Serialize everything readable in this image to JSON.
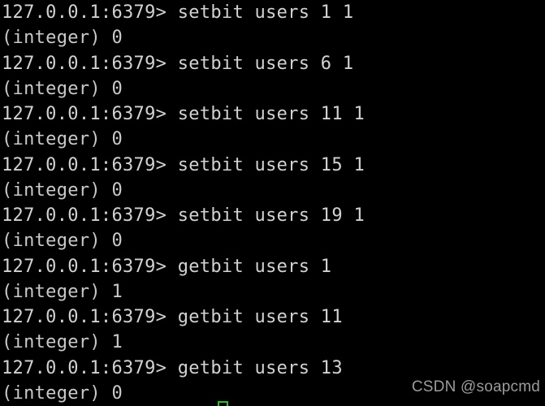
{
  "terminal": {
    "background_color": "#000000",
    "text_color": "#cfcfcf",
    "cursor_color": "#22c322",
    "prompt": "127.0.0.1:6379>",
    "lines": [
      {
        "type": "prompt",
        "text": "127.0.0.1:6379> setbit users 1 1"
      },
      {
        "type": "reply",
        "text": "(integer) 0"
      },
      {
        "type": "prompt",
        "text": "127.0.0.1:6379> setbit users 6 1"
      },
      {
        "type": "reply",
        "text": "(integer) 0"
      },
      {
        "type": "prompt",
        "text": "127.0.0.1:6379> setbit users 11 1"
      },
      {
        "type": "reply",
        "text": "(integer) 0"
      },
      {
        "type": "prompt",
        "text": "127.0.0.1:6379> setbit users 15 1"
      },
      {
        "type": "reply",
        "text": "(integer) 0"
      },
      {
        "type": "prompt",
        "text": "127.0.0.1:6379> setbit users 19 1"
      },
      {
        "type": "reply",
        "text": "(integer) 0"
      },
      {
        "type": "prompt",
        "text": "127.0.0.1:6379> getbit users 1"
      },
      {
        "type": "reply",
        "text": "(integer) 1"
      },
      {
        "type": "prompt",
        "text": "127.0.0.1:6379> getbit users 11"
      },
      {
        "type": "reply",
        "text": "(integer) 1"
      },
      {
        "type": "prompt",
        "text": "127.0.0.1:6379> getbit users 13"
      },
      {
        "type": "reply",
        "text": "(integer) 0"
      }
    ],
    "commands": [
      {
        "command": "setbit users 1 1",
        "result": "(integer) 0"
      },
      {
        "command": "setbit users 6 1",
        "result": "(integer) 0"
      },
      {
        "command": "setbit users 11 1",
        "result": "(integer) 0"
      },
      {
        "command": "setbit users 15 1",
        "result": "(integer) 0"
      },
      {
        "command": "setbit users 19 1",
        "result": "(integer) 0"
      },
      {
        "command": "getbit users 1",
        "result": "(integer) 1"
      },
      {
        "command": "getbit users 11",
        "result": "(integer) 1"
      },
      {
        "command": "getbit users 13",
        "result": "(integer) 0"
      }
    ]
  },
  "watermark": {
    "text": "CSDN @soapcmd"
  }
}
